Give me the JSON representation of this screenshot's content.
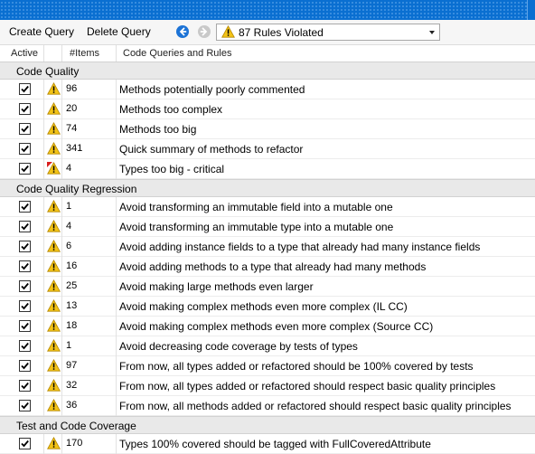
{
  "toolbar": {
    "create_query": "Create Query",
    "delete_query": "Delete Query",
    "back_icon": "arrow-left-circle",
    "forward_icon": "arrow-right-circle",
    "filter_value": "87 Rules Violated"
  },
  "columns": {
    "active": "Active",
    "items": "#Items",
    "rules": "Code Queries and Rules"
  },
  "colors": {
    "titlebar": "#0a6fd1",
    "warning": "#f3c316",
    "critical": "#d81e1e"
  },
  "groups": [
    {
      "name": "Code Quality",
      "rules": [
        {
          "active": true,
          "icon": "warning",
          "count": "96",
          "name": "Methods potentially poorly commented"
        },
        {
          "active": true,
          "icon": "warning",
          "count": "20",
          "name": "Methods too complex"
        },
        {
          "active": true,
          "icon": "warning",
          "count": "74",
          "name": "Methods too big"
        },
        {
          "active": true,
          "icon": "warning",
          "count": "341",
          "name": "Quick summary of methods to refactor"
        },
        {
          "active": true,
          "icon": "critical-warning",
          "count": "4",
          "name": "Types too big - critical"
        }
      ]
    },
    {
      "name": "Code Quality Regression",
      "rules": [
        {
          "active": true,
          "icon": "warning",
          "count": "1",
          "name": "Avoid transforming an immutable field into a mutable one"
        },
        {
          "active": true,
          "icon": "warning",
          "count": "4",
          "name": "Avoid transforming an immutable type into a mutable one"
        },
        {
          "active": true,
          "icon": "warning",
          "count": "6",
          "name": "Avoid adding instance fields to a type that already had many instance fields"
        },
        {
          "active": true,
          "icon": "warning",
          "count": "16",
          "name": "Avoid adding methods to a type that already had many methods"
        },
        {
          "active": true,
          "icon": "warning",
          "count": "25",
          "name": "Avoid making large methods even larger"
        },
        {
          "active": true,
          "icon": "warning",
          "count": "13",
          "name": "Avoid making complex methods even more complex (IL CC)"
        },
        {
          "active": true,
          "icon": "warning",
          "count": "18",
          "name": "Avoid making complex methods even more complex (Source CC)"
        },
        {
          "active": true,
          "icon": "warning",
          "count": "1",
          "name": "Avoid decreasing code coverage by tests of types"
        },
        {
          "active": true,
          "icon": "warning",
          "count": "97",
          "name": "From now, all types added or refactored should be 100% covered by tests"
        },
        {
          "active": true,
          "icon": "warning",
          "count": "32",
          "name": "From now, all types added or refactored should respect basic quality principles"
        },
        {
          "active": true,
          "icon": "warning",
          "count": "36",
          "name": "From now, all methods added or refactored should respect basic quality principles"
        }
      ]
    },
    {
      "name": "Test and Code Coverage",
      "rules": [
        {
          "active": true,
          "icon": "warning",
          "count": "170",
          "name": "Types 100% covered should be tagged with FullCoveredAttribute"
        }
      ]
    }
  ]
}
